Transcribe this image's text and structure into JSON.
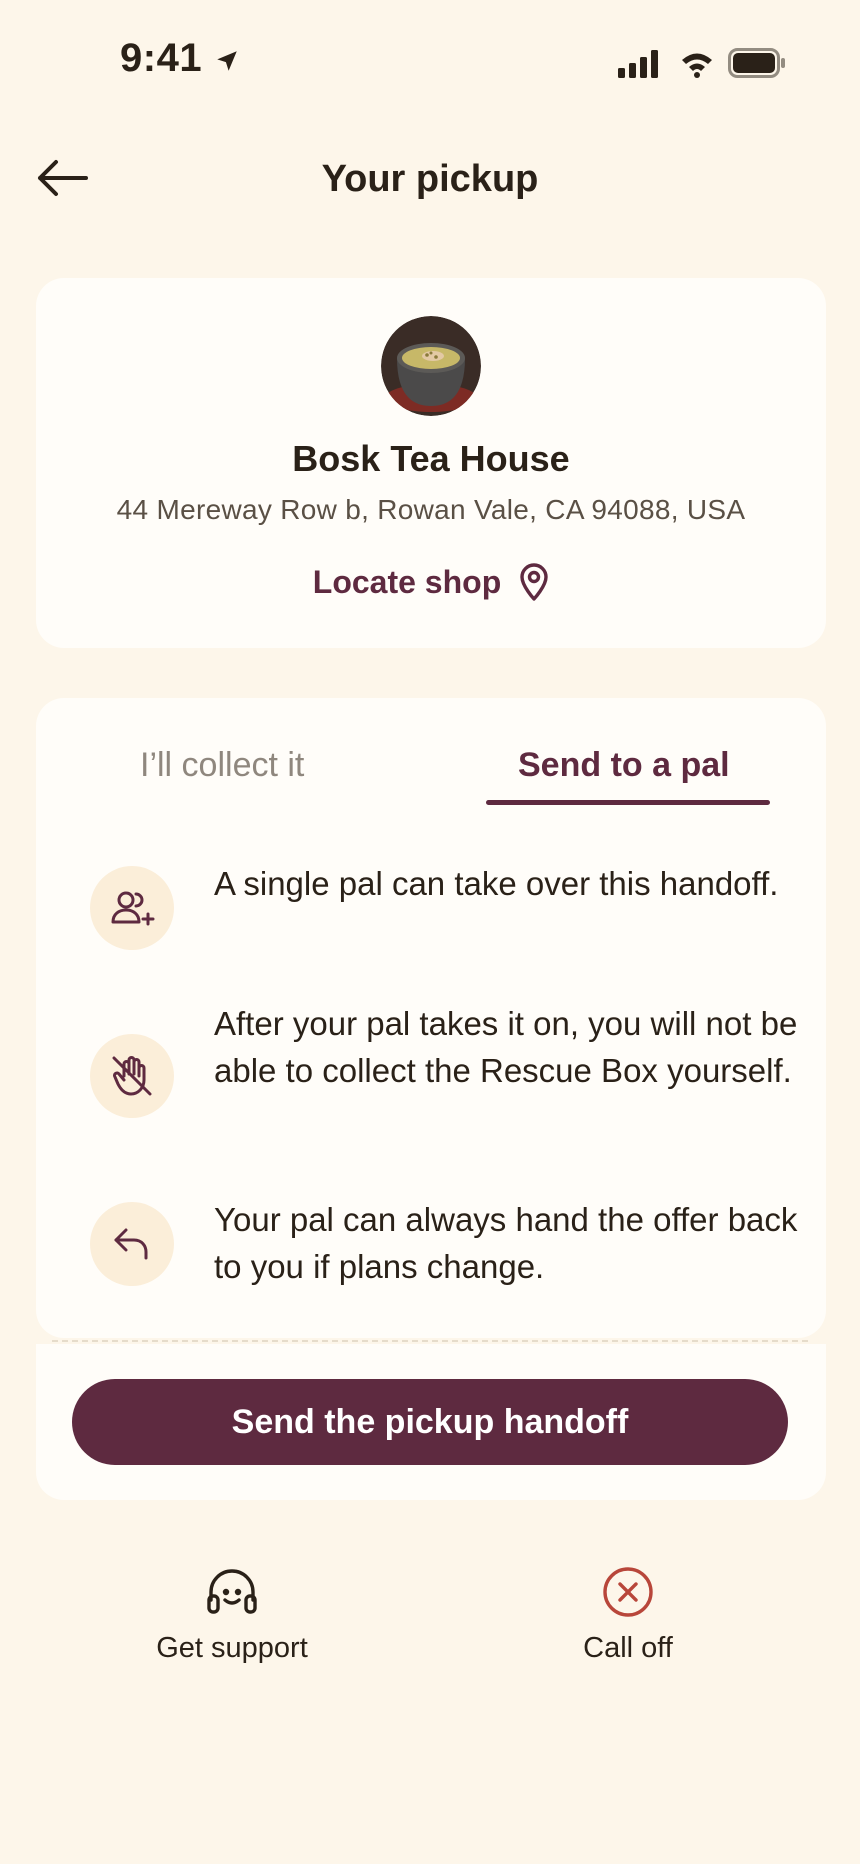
{
  "status_bar": {
    "time": "9:41"
  },
  "header": {
    "title": "Your pickup"
  },
  "shop": {
    "name": "Bosk Tea House",
    "address": "44 Mereway Row b, Rowan Vale, CA 94088, USA",
    "locate_label": "Locate shop"
  },
  "tabs": [
    {
      "label": "I’ll collect it",
      "selected": false
    },
    {
      "label": "Send to a pal",
      "selected": true
    }
  ],
  "info_items": [
    {
      "icon": "user-plus-icon",
      "text": "A single pal can take over this handoff."
    },
    {
      "icon": "hand-off-icon",
      "text": "After your pal takes it on, you will not be able to collect the Rescue Box yourself."
    },
    {
      "icon": "undo-arrow-icon",
      "text": "Your pal can always hand the offer back to you if plans change."
    }
  ],
  "cta": {
    "label": "Send the pickup handoff"
  },
  "actions": {
    "support_label": "Get support",
    "calloff_label": "Call off"
  },
  "colors": {
    "background": "#fdf6ea",
    "accent": "#5e2a40",
    "danger": "#b8463a",
    "icon_bg": "#fbeed9"
  }
}
